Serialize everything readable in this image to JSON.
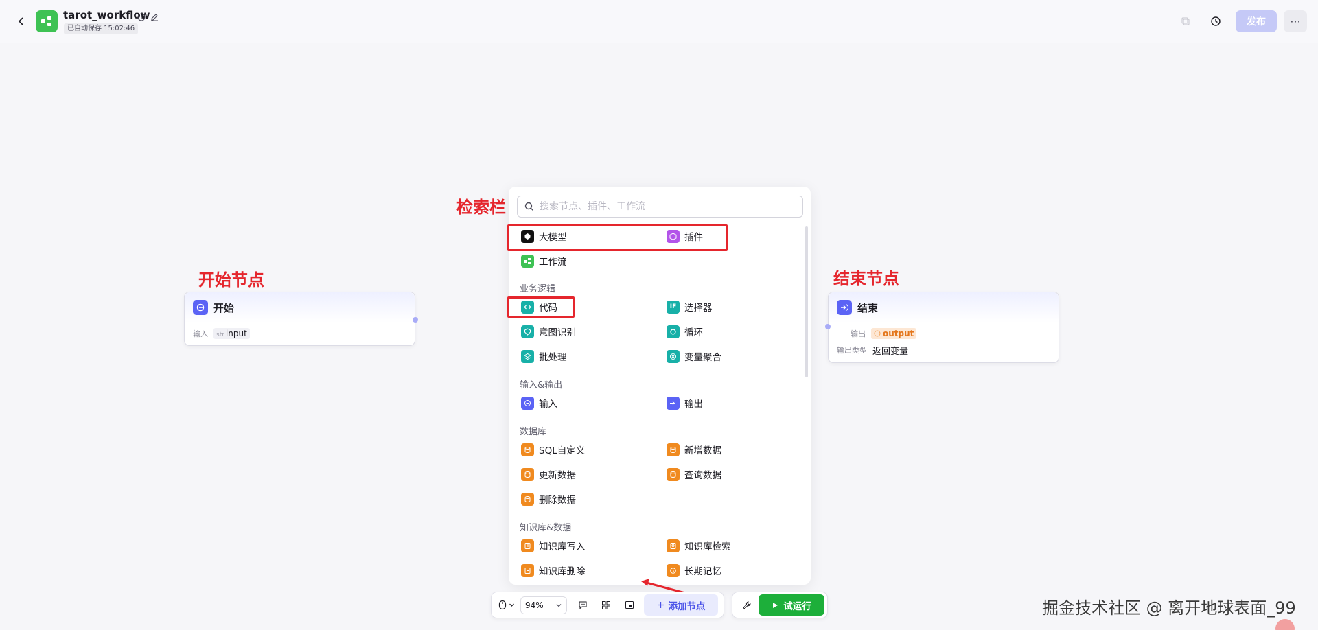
{
  "header": {
    "title": "tarot_workflow",
    "autosave": "已自动保存 15:02:46",
    "publish_label": "发布",
    "more_label": "···"
  },
  "annotations": {
    "search_bar": "检索栏",
    "start_node": "开始节点",
    "end_node": "结束节点"
  },
  "start_node": {
    "title": "开始",
    "input_label": "输入",
    "input_type": "str",
    "input_name": "input"
  },
  "end_node": {
    "title": "结束",
    "output_label": "输出",
    "output_name": "output",
    "output_type_label": "输出类型",
    "output_type_value": "返回变量"
  },
  "panel": {
    "search_placeholder": "搜索节点、插件、工作流",
    "top_items": [
      {
        "label": "大模型",
        "icon": "llm-icon",
        "color": "#111111"
      },
      {
        "label": "插件",
        "icon": "plugin-icon",
        "color": "#b354e9"
      },
      {
        "label": "工作流",
        "icon": "workflow-icon",
        "color": "#3ec254"
      }
    ],
    "sections": [
      {
        "title": "业务逻辑",
        "items": [
          {
            "label": "代码",
            "icon": "code-icon",
            "color": "#18b0a8"
          },
          {
            "label": "选择器",
            "icon": "if-icon",
            "color": "#18b0a8"
          },
          {
            "label": "意图识别",
            "icon": "intent-icon",
            "color": "#18b0a8"
          },
          {
            "label": "循环",
            "icon": "loop-icon",
            "color": "#18b0a8"
          },
          {
            "label": "批处理",
            "icon": "batch-icon",
            "color": "#18b0a8"
          },
          {
            "label": "变量聚合",
            "icon": "aggregate-icon",
            "color": "#18b0a8"
          }
        ]
      },
      {
        "title": "输入&输出",
        "items": [
          {
            "label": "输入",
            "icon": "input-icon",
            "color": "#5b63f5"
          },
          {
            "label": "输出",
            "icon": "output-icon",
            "color": "#5b63f5"
          }
        ]
      },
      {
        "title": "数据库",
        "items": [
          {
            "label": "SQL自定义",
            "icon": "sql-icon",
            "color": "#f08a1f"
          },
          {
            "label": "新增数据",
            "icon": "db-add-icon",
            "color": "#f08a1f"
          },
          {
            "label": "更新数据",
            "icon": "db-update-icon",
            "color": "#f08a1f"
          },
          {
            "label": "查询数据",
            "icon": "db-query-icon",
            "color": "#f08a1f"
          },
          {
            "label": "删除数据",
            "icon": "db-delete-icon",
            "color": "#f08a1f"
          }
        ]
      },
      {
        "title": "知识库&数据",
        "items": [
          {
            "label": "知识库写入",
            "icon": "kb-write-icon",
            "color": "#f08a1f"
          },
          {
            "label": "知识库检索",
            "icon": "kb-search-icon",
            "color": "#f08a1f"
          },
          {
            "label": "知识库删除",
            "icon": "kb-delete-icon",
            "color": "#f08a1f"
          },
          {
            "label": "长期记忆",
            "icon": "memory-icon",
            "color": "#f08a1f"
          }
        ]
      }
    ]
  },
  "toolbar": {
    "zoom": "94%",
    "add_node_label": "添加节点",
    "run_label": "试运行"
  },
  "watermark": "掘金技术社区 @ 离开地球表面_99"
}
